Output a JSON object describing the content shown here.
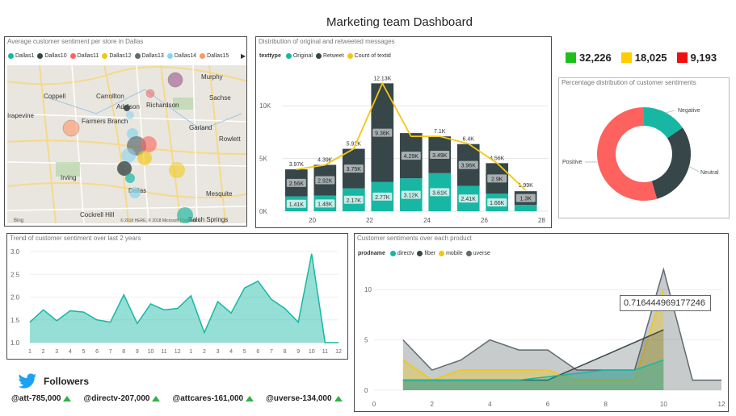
{
  "dashboard": {
    "title": "Marketing team Dashboard"
  },
  "map_panel": {
    "title": "Average customer sentiment per store in Dallas",
    "legend": [
      {
        "label": "Dallas1",
        "color": "#17b7a3"
      },
      {
        "label": "Dallas10",
        "color": "#374649"
      },
      {
        "label": "Dallas11",
        "color": "#fd625e"
      },
      {
        "label": "Dallas12",
        "color": "#f2c80f"
      },
      {
        "label": "Dallas13",
        "color": "#5f6b6d"
      },
      {
        "label": "Dallas14",
        "color": "#8ad4eb"
      },
      {
        "label": "Dallas15",
        "color": "#fe9666"
      }
    ],
    "place_labels": [
      "Murphy",
      "Coppell",
      "Carrollton",
      "Sachse",
      "Addison",
      "Richardson",
      "Irapevine",
      "Farmers Branch",
      "Garland",
      "Rowlett",
      "Irving",
      "Dallas",
      "Mesquite",
      "Cockrell Hill",
      "Balch Springs",
      "Bing",
      "© 2018 HERE, © 2018 Microsoft Corporation"
    ]
  },
  "kpis": [
    {
      "value": "32,226",
      "color": "#1fbf1f"
    },
    {
      "value": "18,025",
      "color": "#ffcc00"
    },
    {
      "value": "9,193",
      "color": "#ee1111"
    }
  ],
  "bar_panel": {
    "title": "Distribution of original and retweeted messages",
    "legend_head": "texttype",
    "legend": [
      {
        "label": "Original",
        "color": "#17b7a3"
      },
      {
        "label": "Retweet",
        "color": "#374649"
      },
      {
        "label": "Count of textid",
        "color": "#f2c80f"
      }
    ]
  },
  "donut_panel": {
    "title": "Percentage distribution of customer sentiments",
    "labels": {
      "negative": "Negative",
      "neutral": "Neutral",
      "positive": "Positive"
    }
  },
  "trend_panel": {
    "title": "Trend of customer sentiment over last 2 years"
  },
  "product_panel": {
    "title": "Customer sentiments over each product",
    "legend_head": "prodname",
    "legend": [
      {
        "label": "directv",
        "color": "#17b7a3"
      },
      {
        "label": "fiber",
        "color": "#374649"
      },
      {
        "label": "mobile",
        "color": "#f2c80f"
      },
      {
        "label": "uverse",
        "color": "#5f6b6d"
      }
    ],
    "tooltip": "0.716444969177246"
  },
  "followers": {
    "title": "Followers",
    "handles": [
      "@att-785,000",
      "@directv-207,000",
      "@attcares-161,000",
      "@uverse-134,000"
    ]
  },
  "chart_data": [
    {
      "type": "bar",
      "title": "Distribution of original and retweeted messages",
      "categories": [
        "19",
        "20",
        "21",
        "22",
        "23",
        "24",
        "25",
        "26",
        "27",
        "28"
      ],
      "xticks": [
        "20",
        "22",
        "24",
        "26",
        "28"
      ],
      "series": [
        {
          "name": "Original",
          "values": [
            1.41,
            1.48,
            2.17,
            2.77,
            3.12,
            3.61,
            2.41,
            1.66,
            0.6,
            null
          ]
        },
        {
          "name": "Retweet",
          "values": [
            2.56,
            2.92,
            3.75,
            9.36,
            4.29,
            3.49,
            3.96,
            2.9,
            1.3,
            null
          ]
        },
        {
          "name": "Count of textid",
          "values": [
            3.97,
            4.39,
            5.92,
            12.13,
            7.1,
            7.1,
            6.4,
            4.56,
            1.99,
            null
          ]
        }
      ],
      "data_labels": {
        "original": [
          "1.41K",
          "1.48K",
          "2.17K",
          "2.77K",
          "3.12K",
          "3.61K",
          "2.41K",
          "1.66K",
          ""
        ],
        "retweet": [
          "2.56K",
          "2.92K",
          "3.75K",
          "9.36K",
          "4.29K",
          "3.49K",
          "3.96K",
          "2.9K",
          "1.3K"
        ],
        "total": [
          "3.97K",
          "4.39K",
          "5.92K",
          "12.13K",
          "",
          "7.1K",
          "6.4K",
          "4.56K",
          "1.99K"
        ]
      },
      "yticks": [
        "0K",
        "5K",
        "10K"
      ],
      "ylim": [
        0,
        13
      ]
    },
    {
      "type": "pie",
      "title": "Percentage distribution of customer sentiments",
      "categories": [
        "Negative",
        "Neutral",
        "Positive"
      ],
      "values": [
        0.155,
        0.3,
        0.545
      ],
      "colors": [
        "#17b7a3",
        "#374649",
        "#fd625e"
      ]
    },
    {
      "type": "area",
      "title": "Trend of customer sentiment over last 2 years",
      "x": [
        "1",
        "2",
        "3",
        "4",
        "5",
        "6",
        "7",
        "8",
        "9",
        "10",
        "11",
        "12",
        "1",
        "2",
        "3",
        "4",
        "5",
        "6",
        "7",
        "8",
        "9",
        "10",
        "11",
        "12"
      ],
      "values": [
        1.45,
        1.72,
        1.48,
        1.7,
        1.67,
        1.5,
        1.45,
        2.05,
        1.42,
        1.85,
        1.72,
        1.75,
        2.03,
        1.22,
        1.9,
        1.65,
        2.2,
        2.35,
        1.95,
        1.75,
        1.45,
        2.95,
        1.0,
        1.0
      ],
      "yticks": [
        "1.0",
        "1.5",
        "2.0",
        "2.5",
        "3.0"
      ],
      "ylim": [
        1.0,
        3.0
      ],
      "color": "#17b7a3"
    },
    {
      "type": "area",
      "title": "Customer sentiments over each product",
      "xticks": [
        "0",
        "2",
        "4",
        "6",
        "8",
        "10",
        "12"
      ],
      "yticks": [
        "0",
        "5",
        "10"
      ],
      "ylim": [
        0,
        12.5
      ],
      "xlim": [
        0,
        12
      ],
      "series": [
        {
          "name": "uverse",
          "x": [
            1,
            2,
            3,
            4,
            5,
            6,
            7,
            8,
            9,
            10,
            11,
            12
          ],
          "values": [
            5,
            2,
            3,
            5,
            4,
            4,
            2,
            2,
            2,
            12,
            1,
            1
          ]
        },
        {
          "name": "mobile",
          "x": [
            1,
            2,
            3,
            4,
            5,
            6,
            7,
            8,
            9,
            10
          ],
          "values": [
            3,
            1,
            2,
            2,
            2,
            2,
            1,
            1,
            1,
            10
          ]
        },
        {
          "name": "fiber",
          "x": [
            1,
            6,
            10
          ],
          "values": [
            1,
            1,
            6
          ]
        },
        {
          "name": "directv",
          "x": [
            1,
            5,
            8,
            9,
            10
          ],
          "values": [
            1,
            1,
            2,
            2,
            3
          ]
        }
      ]
    }
  ]
}
